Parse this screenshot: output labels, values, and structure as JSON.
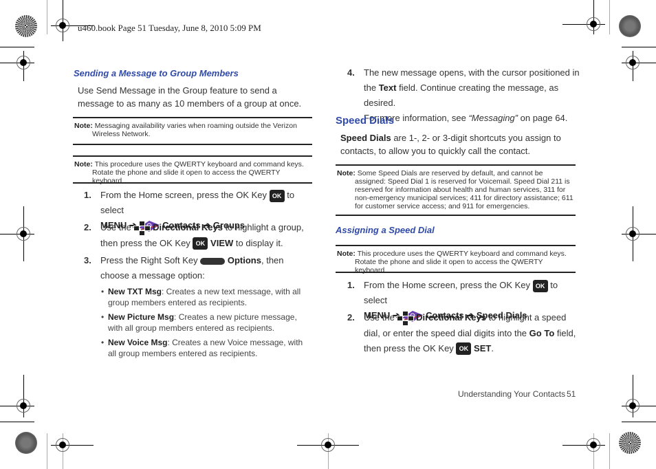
{
  "header": {
    "print_line": "u460.book  Page 51  Tuesday, June 8, 2010  5:09 PM"
  },
  "left": {
    "section_title": "Sending a Message to Group Members",
    "intro": "Use Send Message in the Group feature to send a message to as many as 10 members of a group at once.",
    "note1": {
      "label": "Note:",
      "text": "Messaging availability varies when roaming outside the Verizon Wireless Network."
    },
    "note2": {
      "label": "Note:",
      "text": "This procedure uses the QWERTY keyboard and command keys. Rotate the phone and slide it open to access the QWERTY keyboard."
    },
    "steps": [
      {
        "num": "1.",
        "pre": "From the Home screen, press the OK Key",
        "post": "to select",
        "menu": "MENU",
        "arrow": "➔",
        "contacts": "Contacts",
        "target": "Groups",
        "end": "."
      },
      {
        "num": "2.",
        "pre": "Use the",
        "keys": "Directional Keys",
        "mid": "to highlight a group, then press the OK Key",
        "action": "VIEW",
        "post": "to display it."
      },
      {
        "num": "3.",
        "pre": "Press the Right Soft Key",
        "action": "Options",
        "post": ", then choose a message option:"
      }
    ],
    "options": [
      {
        "label": "New TXT Msg",
        "text": ": Creates a new text message, with all group members entered as recipients."
      },
      {
        "label": "New Picture Msg",
        "text": ": Creates a new picture message, with all group members entered as recipients."
      },
      {
        "label": "New Voice Msg",
        "text": ": Creates a new Voice message, with all group members entered as recipients."
      }
    ]
  },
  "right": {
    "step4": {
      "num": "4.",
      "pre": "The new message opens, with the cursor positioned in the",
      "field": "Text",
      "post": "field.  Continue creating the message, as desired.",
      "more_pre": "For more information, see",
      "more_link": "“Messaging”",
      "more_post": "on page 64."
    },
    "section_title": "Speed Dials",
    "intro_bold": "Speed Dials",
    "intro": "are 1-, 2- or 3-digit shortcuts you assign to contacts, to allow you to quickly call the contact.",
    "note1": {
      "label": "Note:",
      "text": "Some Speed Dials are reserved by default, and cannot be assigned: Speed Dial 1 is reserved for Voicemail. Speed Dial 211 is reserved for information about  health and human services,  311 for non-emergency municipal services; 411 for directory assistance; 611 for customer service access; and 911 for emergencies."
    },
    "subsection_title": "Assigning a Speed Dial",
    "note2": {
      "label": "Note:",
      "text": "This procedure uses the QWERTY keyboard and command keys. Rotate the phone and slide it open to access the QWERTY keyboard."
    },
    "steps": [
      {
        "num": "1.",
        "pre": "From the Home screen, press the OK Key",
        "post": "to select",
        "menu": "MENU",
        "arrow": "➔",
        "contacts": "Contacts",
        "target": "Speed Dials",
        "end": "."
      },
      {
        "num": "2.",
        "pre": "Use the",
        "keys": "Directional Keys",
        "mid": "to highlight a speed dial, or enter the speed dial digits into the",
        "field": "Go To",
        "mid2": "field, then press the OK Key",
        "action": "SET",
        "end": "."
      }
    ]
  },
  "footer": {
    "chapter": "Understanding Your Contacts",
    "page": "51"
  },
  "icons": {
    "ok_key": "OK"
  }
}
